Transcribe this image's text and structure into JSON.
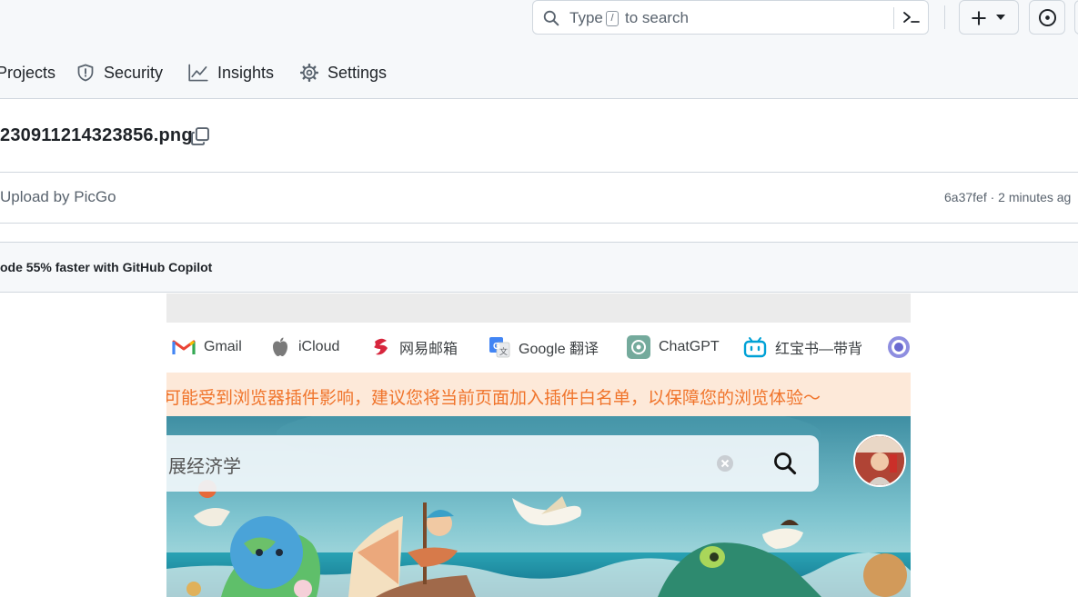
{
  "header": {
    "search": {
      "type_text": "Type",
      "slash_key": "/",
      "suffix_text": "to search"
    }
  },
  "tabs": [
    {
      "label": "Projects",
      "icon": "table-icon"
    },
    {
      "label": "Security",
      "icon": "shield-icon"
    },
    {
      "label": "Insights",
      "icon": "graph-icon"
    },
    {
      "label": "Settings",
      "icon": "gear-icon"
    }
  ],
  "file": {
    "name": "230911214323856.png",
    "commit_message": "Upload by PicGo",
    "commit_hash": "6a37fef",
    "commit_time": "2 minutes ag",
    "separator": "·"
  },
  "banner": {
    "text": "ode 55% faster with GitHub Copilot"
  },
  "screenshot": {
    "bookmarks": [
      {
        "label": "Gmail",
        "icon": "gmail-icon"
      },
      {
        "label": "iCloud",
        "icon": "apple-icon"
      },
      {
        "label": "网易邮箱",
        "icon": "netease-mail-icon"
      },
      {
        "label": "Google 翻译",
        "icon": "google-translate-icon"
      },
      {
        "label": "ChatGPT",
        "icon": "chatgpt-icon"
      },
      {
        "label": "红宝书—带背",
        "icon": "bilibili-icon"
      }
    ],
    "warning": "可能受到浏览器插件影响，建议您将当前页面加入插件白名单，以保障您的浏览体验～",
    "warning_arrow": "›",
    "search_query": "展经济学"
  },
  "colors": {
    "header_bg": "#f6f8fa",
    "border": "#d0d7de",
    "muted_text": "#59636e",
    "warning_bg": "#fde9d9",
    "warning_text": "#f0742b"
  }
}
